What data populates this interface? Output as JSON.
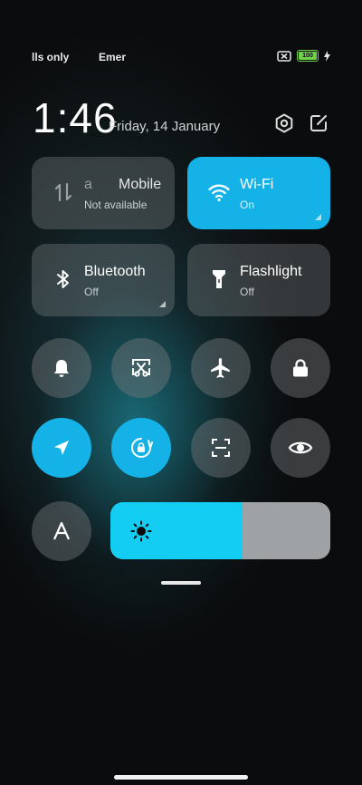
{
  "status_bar": {
    "carrier1": "lls only",
    "carrier2": "Emer",
    "battery_level": "100"
  },
  "header": {
    "time": "1:46",
    "date": "Friday, 14 January"
  },
  "tiles": {
    "mobile": {
      "title_prefix": "a",
      "title": "Mobile",
      "status": "Not available"
    },
    "wifi": {
      "title": "Wi-Fi",
      "status": "On"
    },
    "bluetooth": {
      "title": "Bluetooth",
      "status": "Off"
    },
    "flashlight": {
      "title": "Flashlight",
      "status": "Off"
    }
  },
  "brightness": {
    "level_percent": 60
  },
  "colors": {
    "accent": "#14b2e6",
    "slider_fill": "#14cdf2",
    "battery": "#6fd24a"
  }
}
